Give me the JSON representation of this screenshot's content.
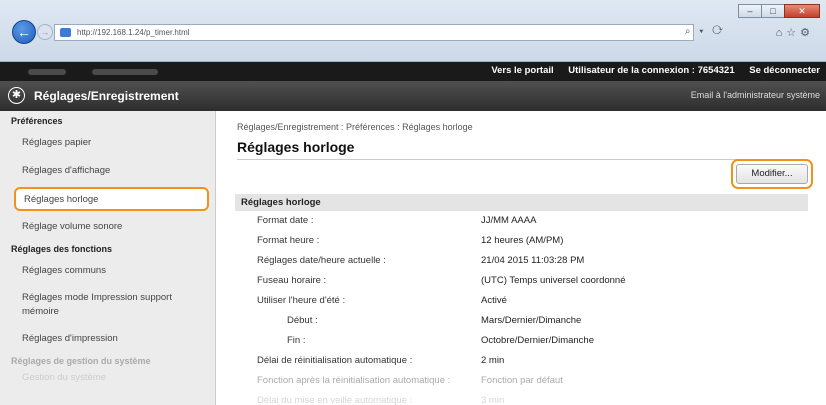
{
  "browser": {
    "url": "http://192.168.1.24/p_timer.html",
    "window_controls": [
      "minimize",
      "maximize",
      "close"
    ]
  },
  "header": {
    "portal_link": "Vers le portail",
    "user_label": "Utilisateur de la connexion : 7654321",
    "logout": "Se déconnecter",
    "app_title": "Réglages/Enregistrement",
    "admin_email": "Email à l'administrateur système"
  },
  "sidebar": {
    "preferences_title": "Préférences",
    "items_prefs": [
      {
        "label": "Réglages papier"
      },
      {
        "label": "Réglages d'affichage"
      },
      {
        "label": "Réglages horloge"
      },
      {
        "label": "Réglage volume sonore"
      }
    ],
    "functions_title": "Réglages des fonctions",
    "items_functions": [
      {
        "label": "Réglages communs"
      },
      {
        "label": "Réglages mode Impression support mémoire"
      },
      {
        "label": "Réglages d'impression"
      }
    ],
    "system_title": "Réglages de gestion du système",
    "item_system": "Gestion du système"
  },
  "main": {
    "breadcrumb": "Réglages/Enregistrement : Préférences : Réglages horloge",
    "page_title": "Réglages horloge",
    "modify_button": "Modifier...",
    "panel_title": "Réglages horloge",
    "rows": [
      {
        "label": "Format date :",
        "value": "JJ/MM AAAA"
      },
      {
        "label": "Format heure :",
        "value": "12 heures (AM/PM)"
      },
      {
        "label": "Réglages date/heure actuelle :",
        "value": "21/04 2015 11:03:28 PM"
      },
      {
        "label": "Fuseau horaire :",
        "value": "(UTC) Temps universel coordonné"
      },
      {
        "label": "Utiliser l'heure d'été :",
        "value": "Activé"
      },
      {
        "label": "Début :",
        "value": "Mars/Dernier/Dimanche"
      },
      {
        "label": "Fin :",
        "value": "Octobre/Dernier/Dimanche"
      },
      {
        "label": "Délai de réinitialisation automatique :",
        "value": "2 min"
      },
      {
        "label": "Fonction après la réinitialisation automatique :",
        "value": "Fonction par défaut"
      },
      {
        "label": "Délai du mise en veille automatique :",
        "value": "3 min"
      }
    ]
  }
}
